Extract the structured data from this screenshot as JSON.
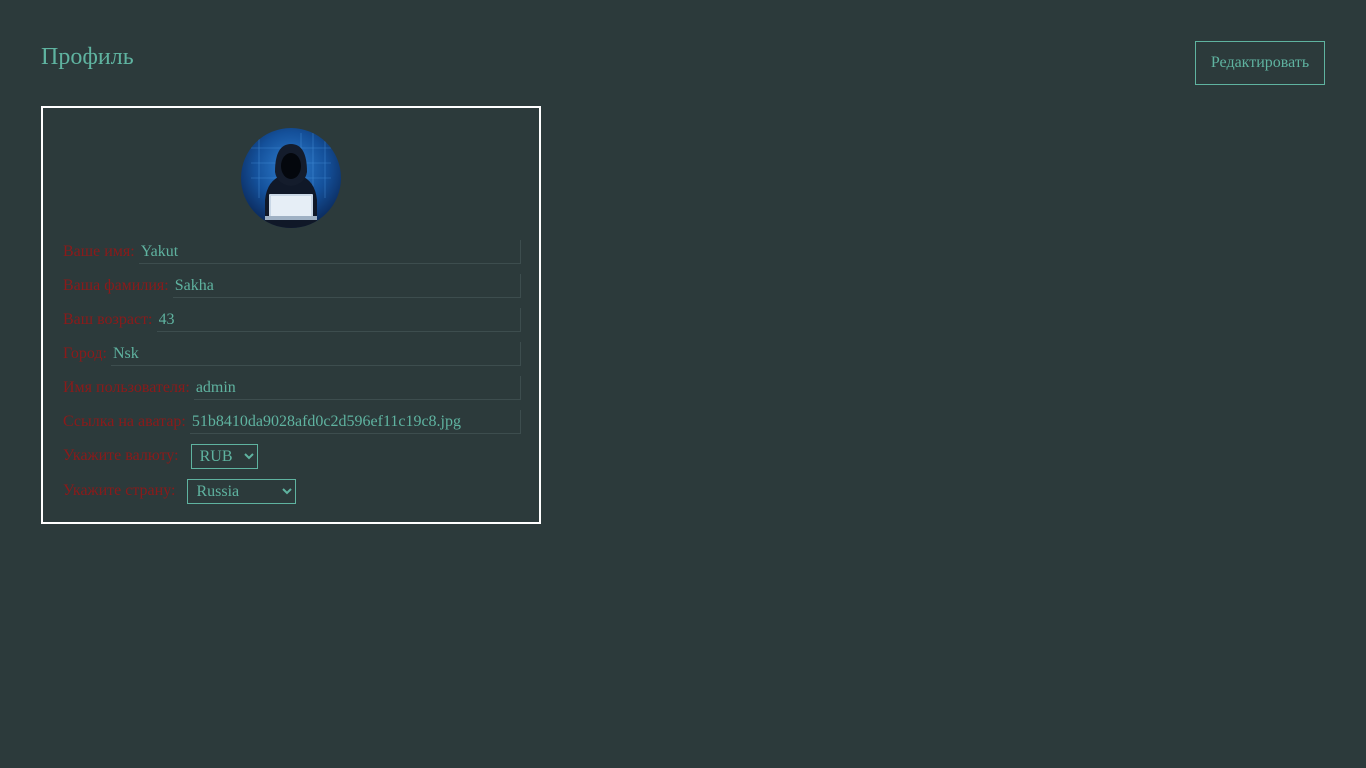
{
  "header": {
    "title": "Профиль",
    "edit_label": "Редактировать"
  },
  "colors": {
    "background": "#2c3a3b",
    "accent": "#5fb3a0",
    "label": "#8b1a1a",
    "card_border": "#ffffff"
  },
  "profile": {
    "avatar_icon": "hooded-hacker-avatar",
    "fields": [
      {
        "label": "Ваше имя:",
        "value": "Yakut"
      },
      {
        "label": "Ваша фамилия:",
        "value": "Sakha"
      },
      {
        "label": "Ваш возраст:",
        "value": "43"
      },
      {
        "label": "Город:",
        "value": "Nsk"
      },
      {
        "label": "Имя пользователя:",
        "value": "admin"
      },
      {
        "label": "Ссылка на аватар:",
        "value": "51b8410da9028afd0c2d596ef11c19c8.jpg"
      }
    ],
    "currency": {
      "label": "Укажите валюту:",
      "selected": "RUB"
    },
    "country": {
      "label": "Укажите страну:",
      "selected": "Russia"
    }
  }
}
